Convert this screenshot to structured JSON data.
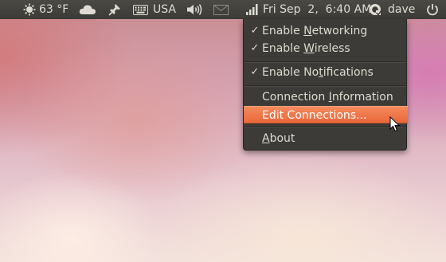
{
  "panel": {
    "weather": "63 °F",
    "keyboard": "USA",
    "clock": "Fri Sep  2,  6:40 AM",
    "user": "dave",
    "icons": [
      "sun-icon",
      "cloud-icon",
      "pin-icon",
      "keyboard-icon",
      "volume-icon",
      "mail-icon",
      "network-signal-icon",
      "user-status-icon",
      "power-icon"
    ]
  },
  "network_menu": {
    "items": [
      {
        "checked": true,
        "pre": "Enable ",
        "accel": "N",
        "post": "etworking"
      },
      {
        "checked": true,
        "pre": "Enable ",
        "accel": "W",
        "post": "ireless"
      },
      {
        "checked": true,
        "pre": "Enable No",
        "accel": "t",
        "post": "ifications"
      },
      {
        "checked": false,
        "pre": "Connection ",
        "accel": "I",
        "post": "nformation"
      },
      {
        "checked": false,
        "pre": "Edit Connections...",
        "accel": "",
        "post": "",
        "highlighted": true
      },
      {
        "checked": false,
        "pre": "",
        "accel": "A",
        "post": "bout"
      }
    ],
    "check_glyph": "✓"
  },
  "colors": {
    "panel_bg": "#3c3b37",
    "menu_bg": "#3c3b37",
    "highlight": "#ef7847",
    "text": "#dfdbd2"
  }
}
